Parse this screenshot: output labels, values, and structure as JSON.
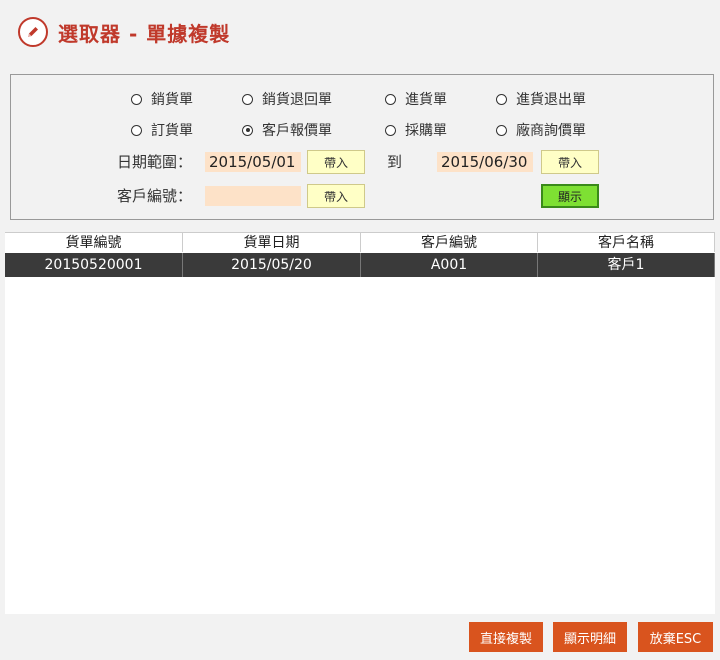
{
  "title": "選取器 - 單據複製",
  "doc_types": [
    {
      "label": "銷貨單",
      "checked": false
    },
    {
      "label": "銷貨退回單",
      "checked": false
    },
    {
      "label": "進貨單",
      "checked": false
    },
    {
      "label": "進貨退出單",
      "checked": false
    },
    {
      "label": "訂貨單",
      "checked": false
    },
    {
      "label": "客戶報價單",
      "checked": true
    },
    {
      "label": "採購單",
      "checked": false
    },
    {
      "label": "廠商詢價單",
      "checked": false
    }
  ],
  "date_range": {
    "label": "日期範圍：",
    "start": "2015/05/01",
    "to_label": "到",
    "end": "2015/06/30",
    "insert_label": "帶入"
  },
  "customer": {
    "label": "客戶編號：",
    "value": "",
    "insert_label": "帶入"
  },
  "show_label": "顯示",
  "table": {
    "columns": [
      "貨單編號",
      "貨單日期",
      "客戶編號",
      "客戶名稱"
    ],
    "rows": [
      [
        "20150520001",
        "2015/05/20",
        "A001",
        "客戶1"
      ]
    ]
  },
  "footer": {
    "copy_label": "直接複製",
    "detail_label": "顯示明細",
    "cancel_label": "放棄ESC"
  },
  "colors": {
    "title": "#c0392b",
    "input_bg": "#fde2c8",
    "insert_btn_bg": "#ffffc6",
    "show_btn_bg": "#7ee033",
    "row_selected_bg": "#3a3a3a",
    "footer_btn_bg": "#d9541e"
  }
}
